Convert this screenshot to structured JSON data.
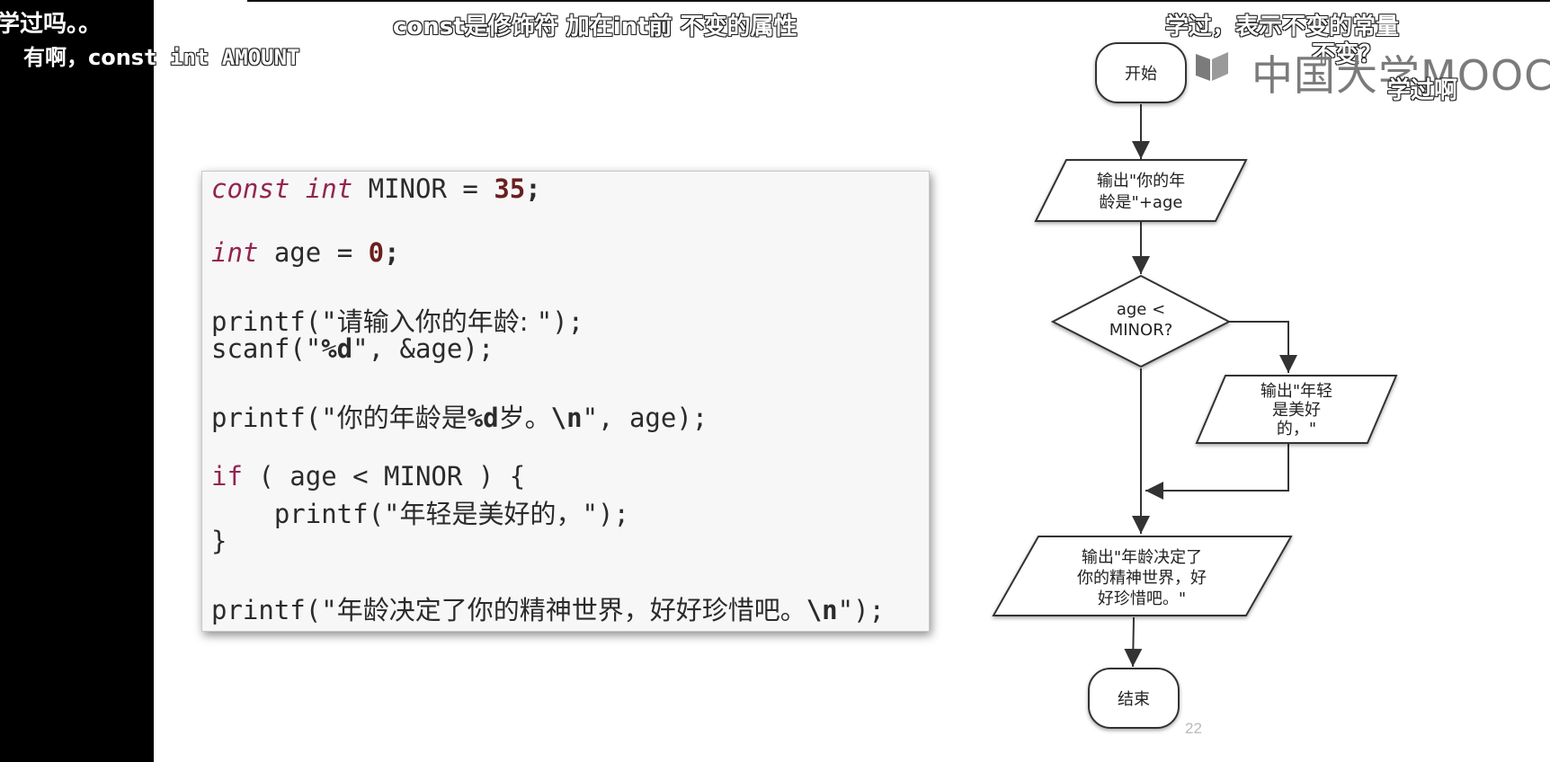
{
  "danmaku": {
    "d1": "学过吗。。",
    "d2": "有啊，cons",
    "d2_tail": "t int AMOUNT",
    "d3": "const是修饰符 加在int前 不变的属性",
    "d4": "学过，表示不变的常量",
    "d5": "不变？",
    "d6": "学过啊"
  },
  "logo": {
    "text": "中国大学MOOC"
  },
  "code": {
    "l1": {
      "kw1": "const",
      "kw2": "int",
      "rest": " MINOR = ",
      "num": "35",
      "end": ";"
    },
    "l2": {
      "kw": "int",
      "rest": " age = ",
      "num": "0",
      "end": ";"
    },
    "l3": {
      "pre": "printf(\"",
      "cn": "请输入你的年龄: ",
      "post": "\");"
    },
    "l4": {
      "pre": "scanf(\"",
      "fmt": "%d",
      "post": "\", &age);"
    },
    "l5": {
      "pre": "printf(\"",
      "cn": "你的年龄是",
      "fmt": "%d",
      "cn2": "岁。",
      "esc": "\\n",
      "post": "\", age);"
    },
    "l6": {
      "kw": "if",
      "rest": " ( age < MINOR ) {"
    },
    "l7": {
      "pre": "    printf(\"",
      "cn": "年轻是美好的，",
      "post": "\");"
    },
    "l8": {
      "text": "}"
    },
    "l9": {
      "pre": "printf(\"",
      "cn": "年龄决定了你的精神世界，好好珍惜吧。",
      "esc": "\\n",
      "post": "\");"
    }
  },
  "flowchart": {
    "start": "开始",
    "out1_l1": "输出\"你的年",
    "out1_l2": "龄是\"+age",
    "cond_l1": "age <",
    "cond_l2": "MINOR?",
    "out2_l1": "输出\"年轻",
    "out2_l2": "是美好",
    "out2_l3": "的，\"",
    "out3_l1": "输出\"年龄决定了",
    "out3_l2": "你的精神世界，好",
    "out3_l3": "好珍惜吧。\"",
    "end": "结束"
  },
  "slide": {
    "page_number": "22"
  }
}
